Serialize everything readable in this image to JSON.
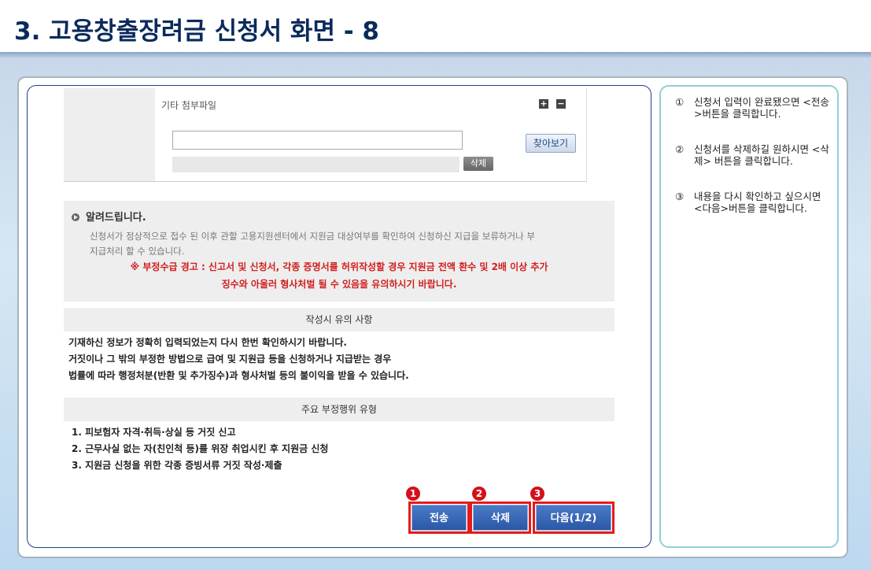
{
  "header": {
    "title": "3. 고용창출장려금 신청서 화면 - 8"
  },
  "attachment": {
    "title": "기타 첨부파일",
    "add_icon": "plus-icon",
    "remove_icon": "minus-icon",
    "browse_label": "찾아보기",
    "delete_label": "삭제",
    "file_value": ""
  },
  "notice": {
    "heading": "알려드립니다.",
    "body_line1": "신청서가 정상적으로 접수 된 이후 관할 고용지원센터에서 지원금 대상여부를 확인하여 신청하신 지급을 보류하거나 부",
    "body_line2": "지급처리 할 수 있습니다.",
    "warn_line1": "※ 부정수급 경고 : 신고서 및 신청서, 각종 증명서를 허위작성할 경우 지원금 전액 환수 및 2배 이상 추가",
    "warn_line2": "징수와 아울러 형사처벌 될 수 있음을 유의하시기 바랍니다."
  },
  "notes_section": {
    "heading": "작성시 유의 사항",
    "lines": [
      "기재하신 정보가 정확히 입력되었는지 다시 한번 확인하시기 바랍니다.",
      "거짓이나 그 밖의 부정한 방법으로 급여 및 지원급 등을 신청하거나 지급받는 경우",
      "법률에 따라 행정처분(반환 및 추가징수)과 형사처벌 등의 불이익을 받을 수 있습니다."
    ]
  },
  "fraud_section": {
    "heading": "주요 부정행위 유형",
    "lines": [
      "1. 피보험자 자격·취득·상실 등 거짓 신고",
      "2. 근무사실 없는 자(친인척 등)를 위장 취업시킨 후 지원금 신청",
      "3. 지원금 신청을 위한 각종 증빙서류 거짓 작성·제출"
    ]
  },
  "actions": {
    "send_label": "전송",
    "delete_label": "삭제",
    "next_label": "다음(1/2)",
    "badge1": "1",
    "badge2": "2",
    "badge3": "3"
  },
  "instructions": [
    {
      "num": "①",
      "text": "신청서 입력이 완료됐으면 <전송>버튼을 클릭합니다."
    },
    {
      "num": "②",
      "text": "신청서를 삭제하길 원하시면 <삭제> 버튼을 클릭합니다."
    },
    {
      "num": "③",
      "text": "내용을 다시 확인하고 싶으시면 <다음>버튼을 클릭합니다."
    }
  ],
  "colors": {
    "title": "#0a2a5c",
    "warn": "#d21e1e",
    "button": "#2a58a8",
    "highlight": "#e51a1a"
  }
}
